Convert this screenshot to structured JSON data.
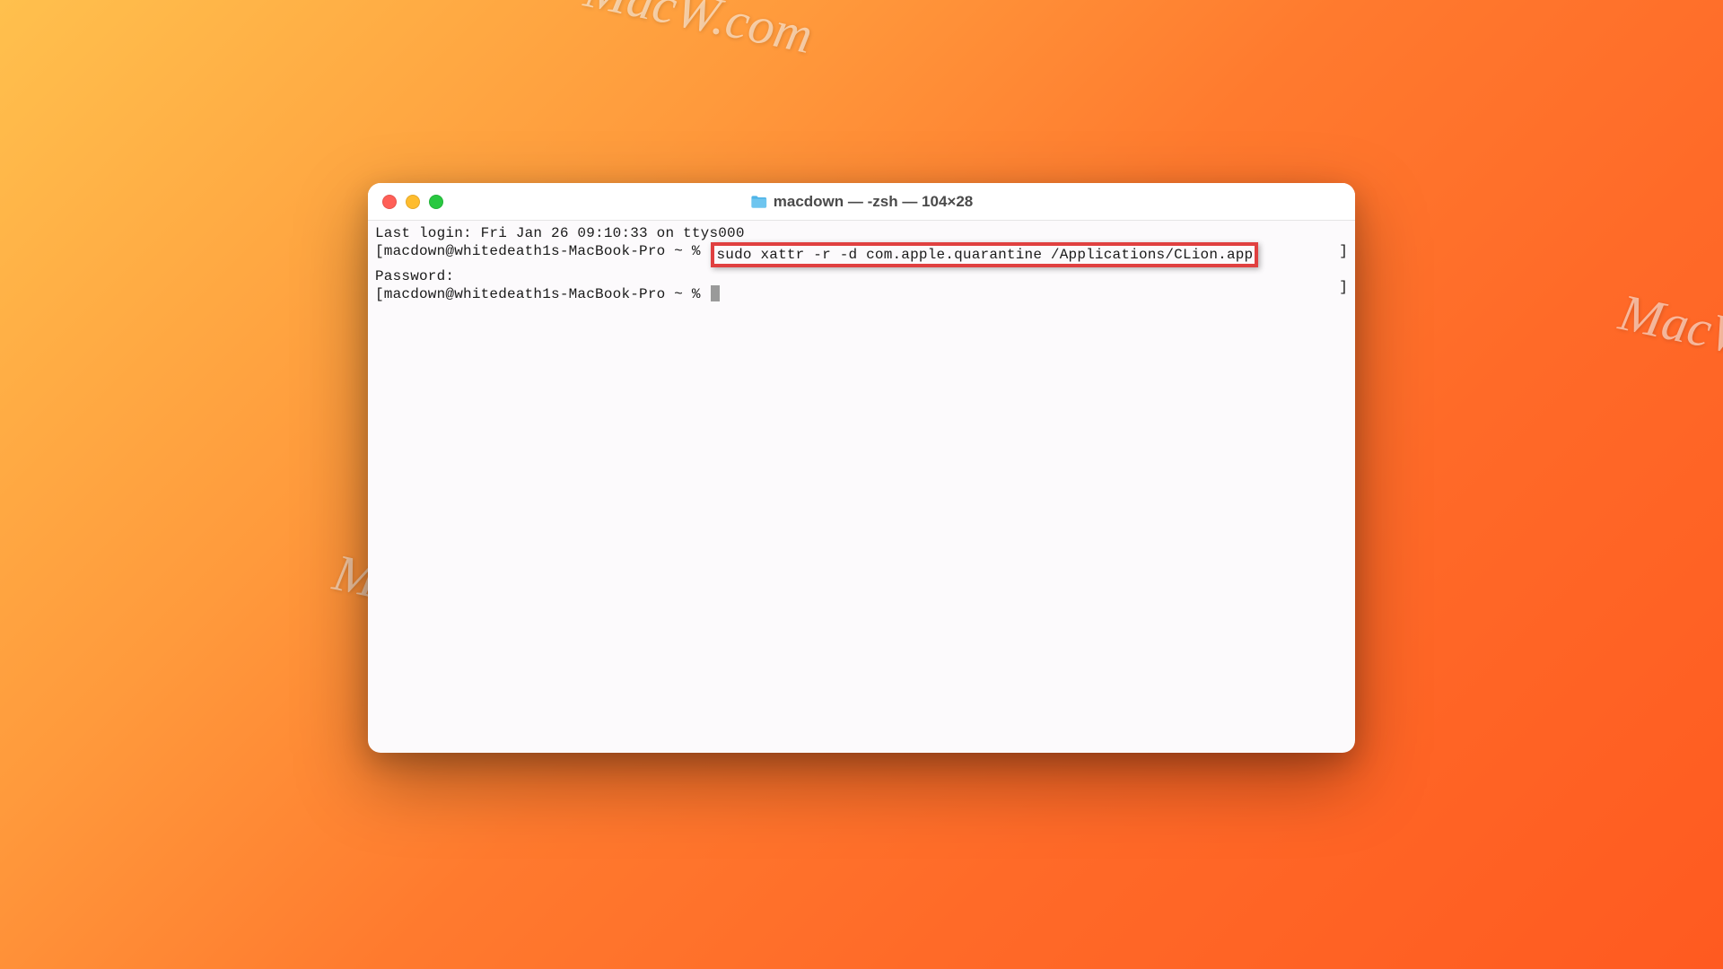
{
  "watermark_text": "MacW.com",
  "window": {
    "title": "macdown — -zsh — 104×28"
  },
  "terminal": {
    "line1": "Last login: Fri Jan 26 09:10:33 on ttys000",
    "prompt1_prefix": "[macdown@whitedeath1s-MacBook-Pro ~ % ",
    "highlighted_command": "sudo xattr -r -d com.apple.quarantine /Applications/CLion.app",
    "line2": "Password:",
    "prompt2": "[macdown@whitedeath1s-MacBook-Pro ~ % ",
    "right_bracket": "]"
  }
}
